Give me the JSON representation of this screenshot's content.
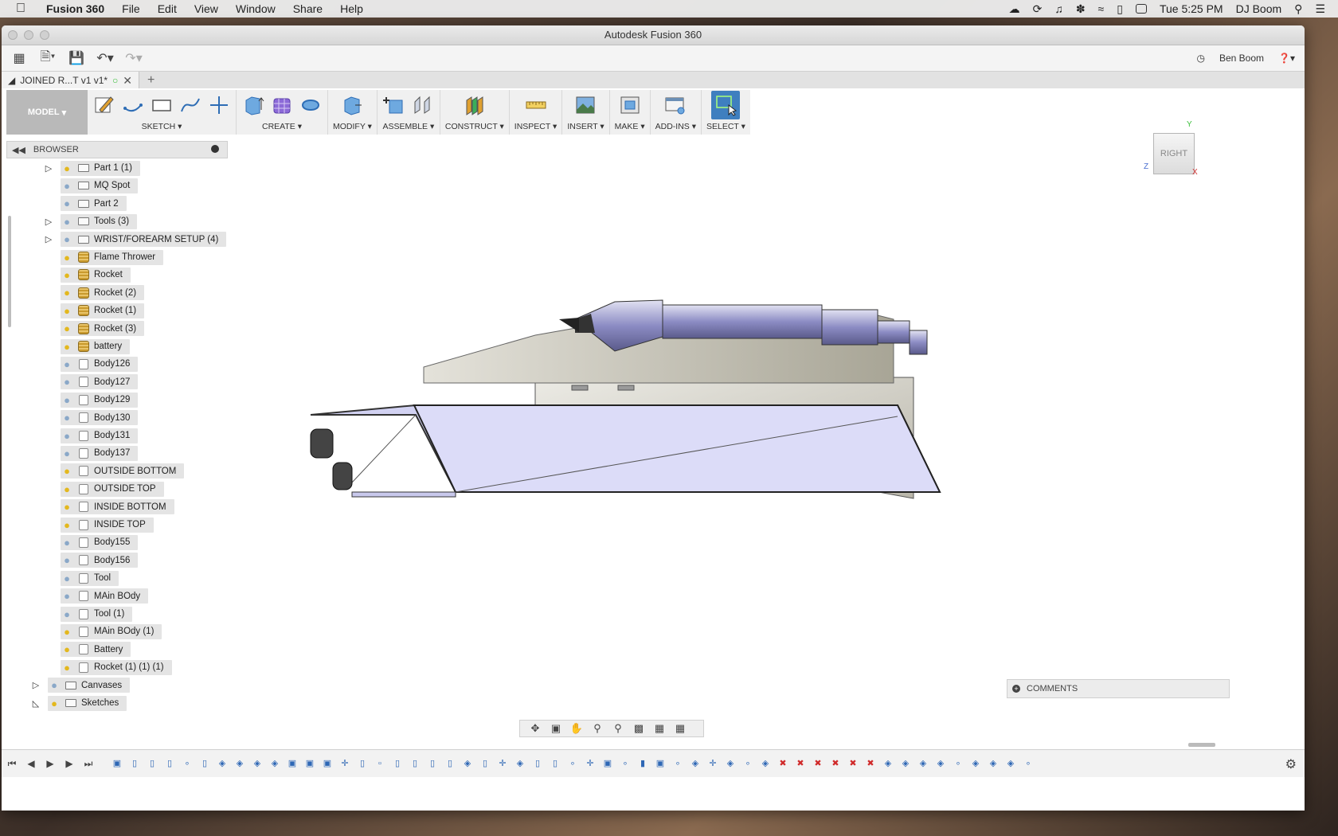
{
  "menubar": {
    "app_name": "Fusion 360",
    "items": [
      "File",
      "Edit",
      "View",
      "Window",
      "Share",
      "Help"
    ],
    "clock": "Tue 5:25 PM",
    "user": "DJ Boom"
  },
  "window": {
    "title": "Autodesk Fusion 360",
    "user_menu": "Ben Boom"
  },
  "tab": {
    "name": "JOINED R...T v1 v1*"
  },
  "ribbon": {
    "workspace": "MODEL",
    "groups": [
      {
        "label": "SKETCH"
      },
      {
        "label": "CREATE"
      },
      {
        "label": "MODIFY"
      },
      {
        "label": "ASSEMBLE"
      },
      {
        "label": "CONSTRUCT"
      },
      {
        "label": "INSPECT"
      },
      {
        "label": "INSERT"
      },
      {
        "label": "MAKE"
      },
      {
        "label": "ADD-INS"
      },
      {
        "label": "SELECT"
      }
    ]
  },
  "browser": {
    "title": "BROWSER",
    "items": [
      {
        "label": "Part 1 (1)",
        "kind": "folder",
        "bulb": "on",
        "expander": true
      },
      {
        "label": "MQ Spot",
        "kind": "folder",
        "bulb": "off",
        "expander": false
      },
      {
        "label": "Part 2",
        "kind": "folder",
        "bulb": "off",
        "expander": false
      },
      {
        "label": "Tools (3)",
        "kind": "folder",
        "bulb": "off",
        "expander": true
      },
      {
        "label": "WRIST/FOREARM SETUP (4)",
        "kind": "folder",
        "bulb": "off",
        "expander": true
      },
      {
        "label": "Flame Thrower",
        "kind": "component",
        "bulb": "on",
        "expander": false
      },
      {
        "label": "Rocket",
        "kind": "component",
        "bulb": "on",
        "expander": false
      },
      {
        "label": "Rocket (2)",
        "kind": "component",
        "bulb": "on",
        "expander": false
      },
      {
        "label": "Rocket (1)",
        "kind": "component",
        "bulb": "on",
        "expander": false
      },
      {
        "label": "Rocket (3)",
        "kind": "component",
        "bulb": "on",
        "expander": false
      },
      {
        "label": "battery",
        "kind": "component",
        "bulb": "on",
        "expander": false
      },
      {
        "label": "Body126",
        "kind": "body",
        "bulb": "off",
        "expander": false
      },
      {
        "label": "Body127",
        "kind": "body",
        "bulb": "off",
        "expander": false
      },
      {
        "label": "Body129",
        "kind": "body",
        "bulb": "off",
        "expander": false
      },
      {
        "label": "Body130",
        "kind": "body",
        "bulb": "off",
        "expander": false
      },
      {
        "label": "Body131",
        "kind": "body",
        "bulb": "off",
        "expander": false
      },
      {
        "label": "Body137",
        "kind": "body",
        "bulb": "off",
        "expander": false
      },
      {
        "label": "OUTSIDE BOTTOM",
        "kind": "body",
        "bulb": "on",
        "expander": false
      },
      {
        "label": "OUTSIDE TOP",
        "kind": "body",
        "bulb": "on",
        "expander": false
      },
      {
        "label": "INSIDE BOTTOM",
        "kind": "body",
        "bulb": "on",
        "expander": false
      },
      {
        "label": "INSIDE TOP",
        "kind": "body",
        "bulb": "on",
        "expander": false
      },
      {
        "label": "Body155",
        "kind": "body",
        "bulb": "off",
        "expander": false
      },
      {
        "label": "Body156",
        "kind": "body",
        "bulb": "off",
        "expander": false
      },
      {
        "label": "Tool",
        "kind": "body",
        "bulb": "off",
        "expander": false
      },
      {
        "label": "MAin BOdy",
        "kind": "body",
        "bulb": "off",
        "expander": false
      },
      {
        "label": "Tool (1)",
        "kind": "body",
        "bulb": "off",
        "expander": false
      },
      {
        "label": "MAin BOdy (1)",
        "kind": "body",
        "bulb": "on",
        "expander": false
      },
      {
        "label": "Battery",
        "kind": "body",
        "bulb": "on",
        "expander": false
      },
      {
        "label": "Rocket (1) (1) (1)",
        "kind": "body",
        "bulb": "on",
        "expander": false
      }
    ],
    "root_items": [
      {
        "label": "Canvases",
        "bulb": "off",
        "expander": "closed"
      },
      {
        "label": "Sketches",
        "bulb": "on",
        "expander": "open"
      }
    ]
  },
  "viewcube": {
    "face": "RIGHT",
    "x": "X",
    "y": "Y",
    "z": "Z"
  },
  "comments": {
    "label": "COMMENTS"
  },
  "colors": {
    "accent": "#3f7fbf",
    "bulb_on": "#e3b81e",
    "bulb_off": "#8aa8c8",
    "model_tint": "#d6d6f4"
  }
}
